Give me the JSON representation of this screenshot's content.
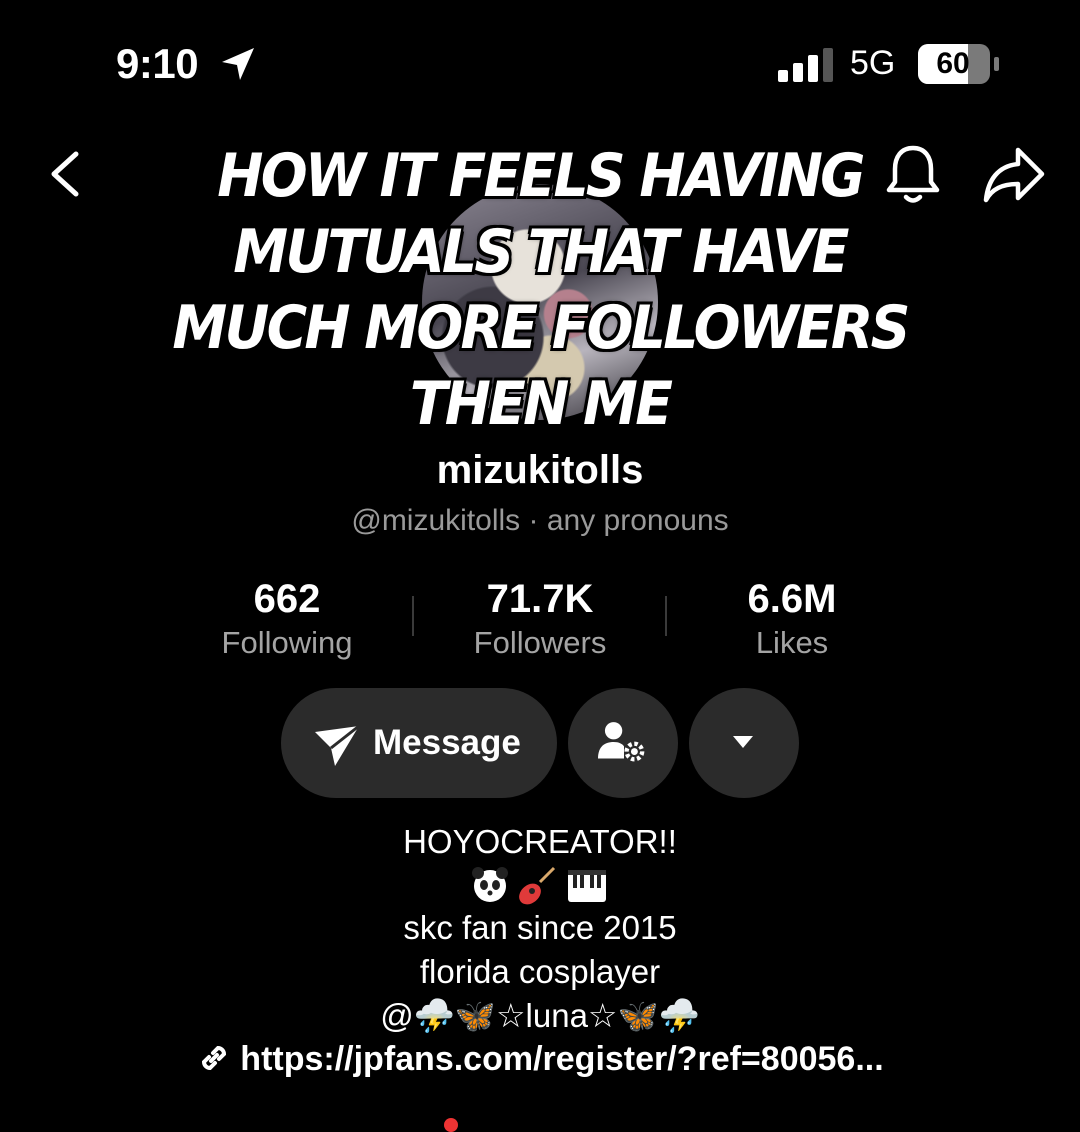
{
  "status_bar": {
    "time": "9:10",
    "network": "5G",
    "battery": "60",
    "location_icon": "location-arrow-icon",
    "signal_icon": "cellular-signal-icon"
  },
  "nav": {
    "back_icon": "chevron-left-icon",
    "bell_icon": "bell-icon",
    "share_icon": "share-arrow-icon"
  },
  "meme_caption": "HOW IT FEELS HAVING MUTUALS THAT HAVE MUCH MORE FOLLOWERS THEN ME",
  "profile": {
    "display_name": "mizukitolls",
    "handle_line": "@mizukitolls · any pronouns"
  },
  "stats": [
    {
      "value": "662",
      "label": "Following"
    },
    {
      "value": "71.7K",
      "label": "Followers"
    },
    {
      "value": "6.6M",
      "label": "Likes"
    }
  ],
  "buttons": {
    "message_label": "Message",
    "message_icon": "paper-plane-icon",
    "manage_icon": "user-settings-icon",
    "more_icon": "caret-down-icon"
  },
  "bio": {
    "line1": "HOYOCREATOR!!",
    "emoji_icons": [
      "panda-icon",
      "guitar-icon",
      "piano-keys-icon"
    ],
    "line3": "skc fan since 2015",
    "line4": "florida cosplayer",
    "line5": "@⛈️🦋☆luna☆🦋⛈️",
    "link": "https://jpfans.com/register/?ref=80056..."
  },
  "colors": {
    "background": "#000000",
    "button_bg": "#2b2b2b",
    "secondary_text": "#9a9a9a"
  }
}
